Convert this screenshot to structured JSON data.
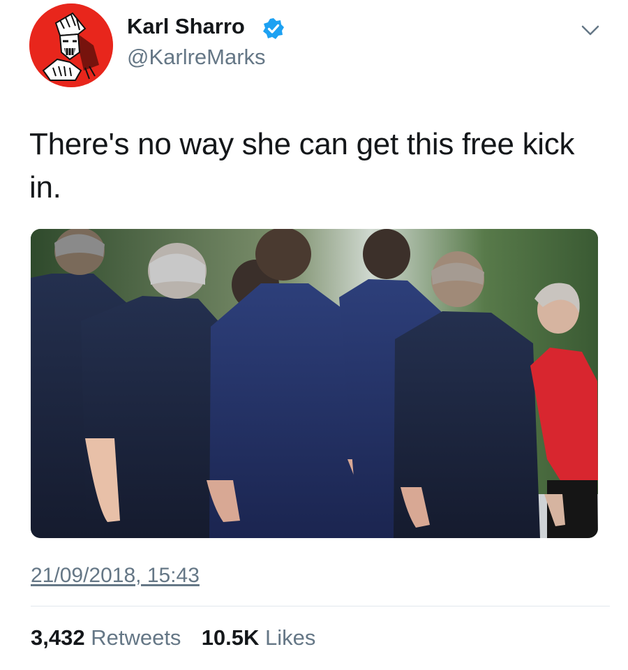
{
  "user": {
    "display_name": "Karl Sharro",
    "handle": "@KarlreMarks",
    "verified_icon": "verified-badge-icon",
    "avatar_icon": "avatar-illustration"
  },
  "menu": {
    "icon": "chevron-down-icon"
  },
  "tweet": {
    "text": "There's no way she can get this free kick in.",
    "media_icon": "photo"
  },
  "timestamp": "21/09/2018, 15:43",
  "stats": {
    "retweets_count": "3,432",
    "retweets_label": "Retweets",
    "likes_count": "10.5K",
    "likes_label": "Likes"
  },
  "colors": {
    "verified": "#1da1f2",
    "secondary_text": "#657786",
    "primary_text": "#14171a",
    "avatar_bg": "#e8261c"
  }
}
